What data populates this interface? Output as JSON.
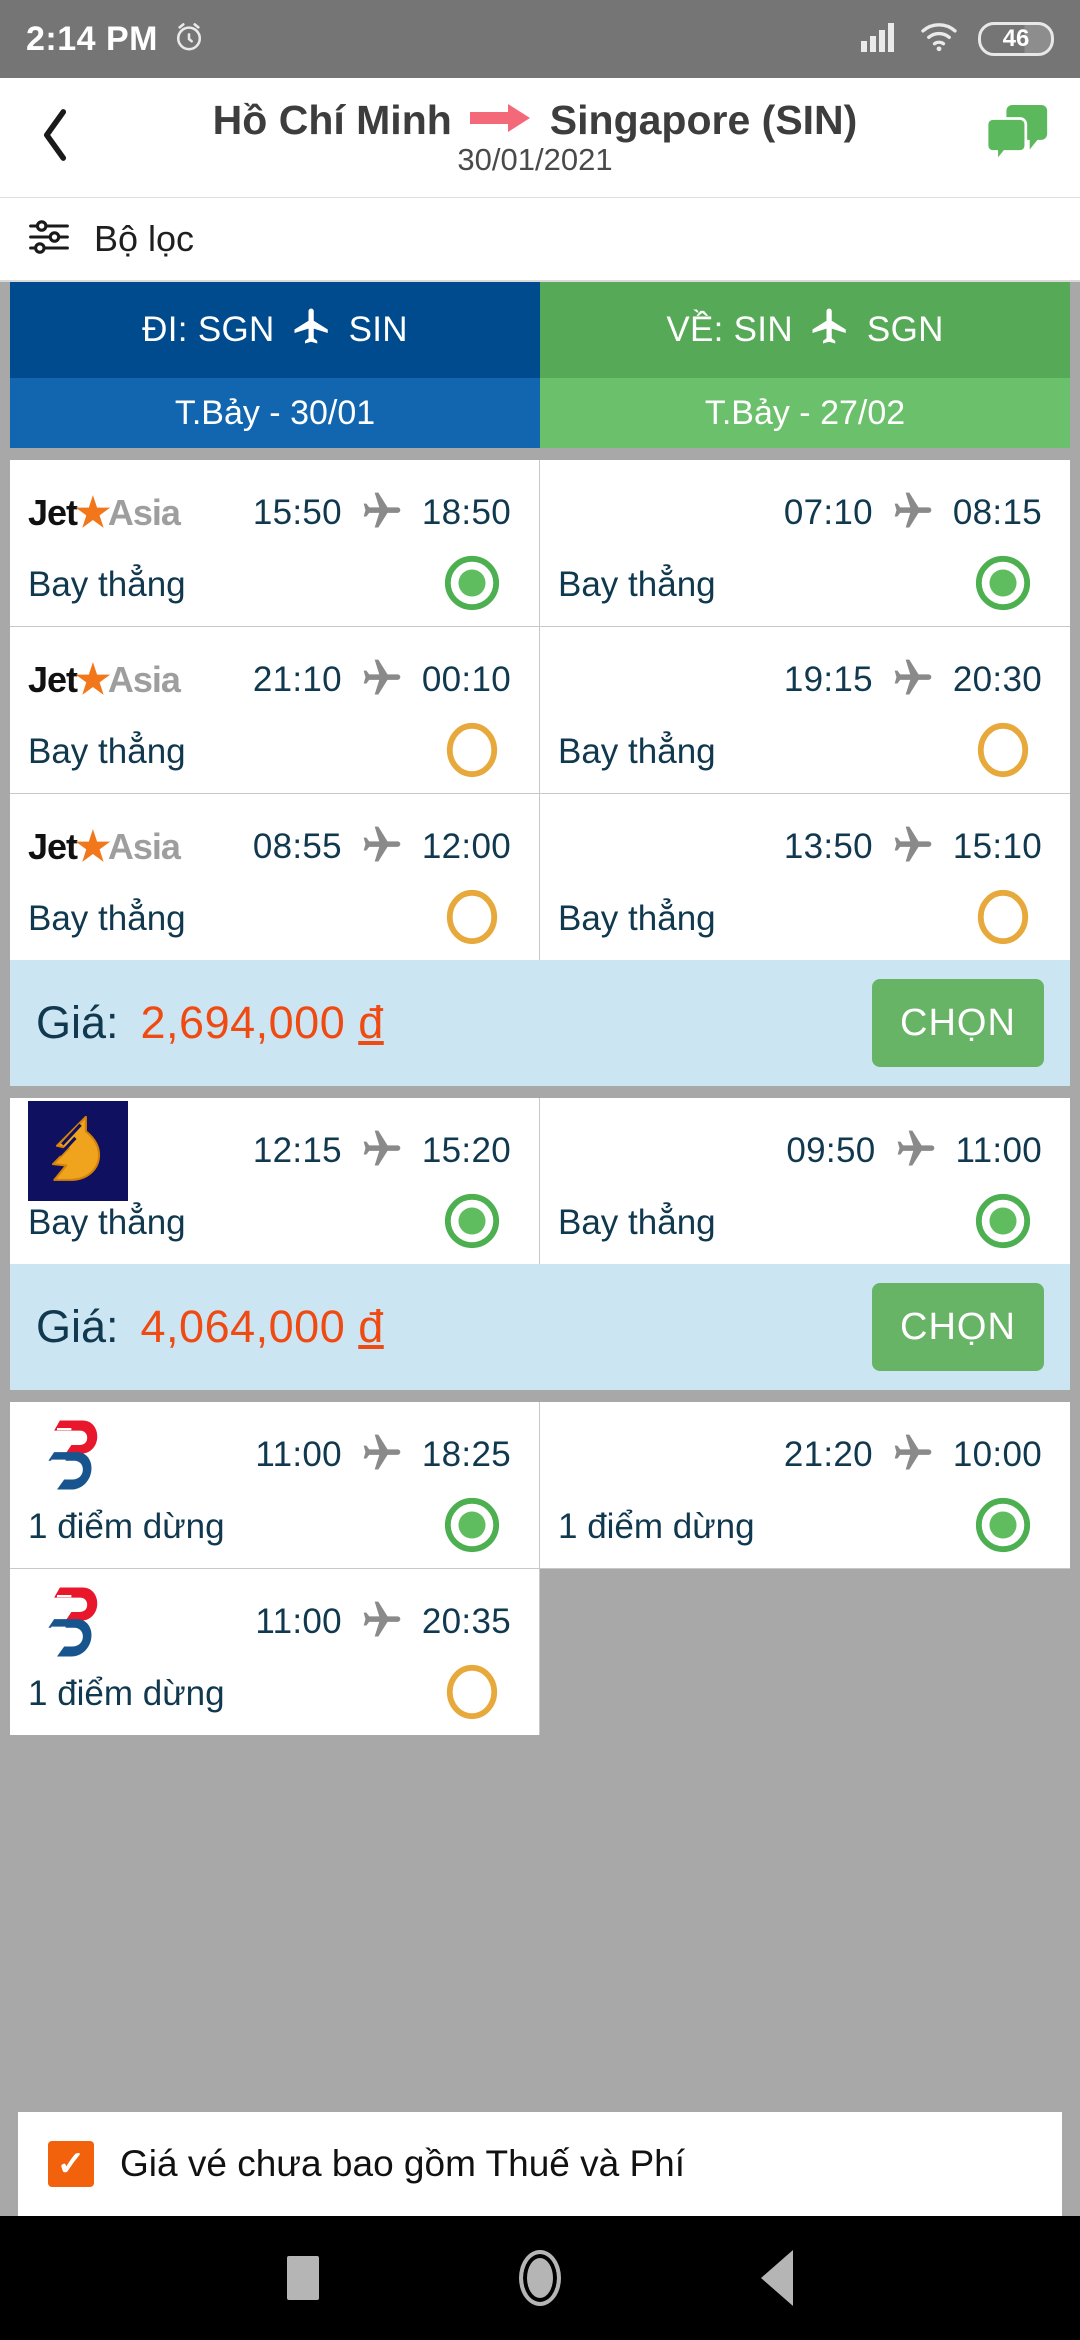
{
  "statusbar": {
    "time": "2:14 PM",
    "alarm_icon": "alarm-clock-icon",
    "signal_icon": "cellular-signal-icon",
    "wifi_icon": "wifi-icon",
    "battery_level": "46"
  },
  "header": {
    "back_icon": "back-chevron-icon",
    "origin": "Hồ Chí Minh",
    "arrow_icon": "arrow-right-icon",
    "destination": "Singapore (SIN)",
    "date": "30/01/2021",
    "chat_icon": "chat-bubbles-icon"
  },
  "filter": {
    "icon": "filter-sliders-icon",
    "label": "Bộ lọc"
  },
  "tabs": [
    {
      "name": "departure",
      "title_prefix": "ĐI: SGN",
      "title_suffix": "SIN",
      "plane_icon": "airplane-icon",
      "date": "T.Bảy - 30/01",
      "color_top": "#004b8d",
      "color_bottom": "#1266b0"
    },
    {
      "name": "return",
      "title_prefix": "VỀ: SIN",
      "title_suffix": "SGN",
      "plane_icon": "airplane-icon",
      "date": "T.Bảy - 27/02",
      "color_top": "#56a956",
      "color_bottom": "#6bc06b"
    }
  ],
  "cards": [
    {
      "rows": [
        {
          "left": {
            "airline": "jetstar-asia",
            "logo_text_a": "Jet",
            "logo_text_b": "Asia",
            "depart": "15:50",
            "arrive": "18:50",
            "stops": "Bay thẳng",
            "selected": true
          },
          "right": {
            "airline": "",
            "depart": "07:10",
            "arrive": "08:15",
            "stops": "Bay thẳng",
            "selected": true
          }
        },
        {
          "left": {
            "airline": "jetstar-asia",
            "logo_text_a": "Jet",
            "logo_text_b": "Asia",
            "depart": "21:10",
            "arrive": "00:10",
            "stops": "Bay thẳng",
            "selected": false
          },
          "right": {
            "airline": "",
            "depart": "19:15",
            "arrive": "20:30",
            "stops": "Bay thẳng",
            "selected": false
          }
        },
        {
          "left": {
            "airline": "jetstar-asia",
            "logo_text_a": "Jet",
            "logo_text_b": "Asia",
            "depart": "08:55",
            "arrive": "12:00",
            "stops": "Bay thẳng",
            "selected": false
          },
          "right": {
            "airline": "",
            "depart": "13:50",
            "arrive": "15:10",
            "stops": "Bay thẳng",
            "selected": false
          }
        }
      ],
      "price_label": "Giá:",
      "price_value": "2,694,000",
      "currency": "đ",
      "choose_label": "CHỌN"
    },
    {
      "rows": [
        {
          "left": {
            "airline": "singapore-airlines",
            "depart": "12:15",
            "arrive": "15:20",
            "stops": "Bay thẳng",
            "selected": true
          },
          "right": {
            "airline": "",
            "depart": "09:50",
            "arrive": "11:00",
            "stops": "Bay thẳng",
            "selected": true
          }
        }
      ],
      "price_label": "Giá:",
      "price_value": "4,064,000",
      "currency": "đ",
      "choose_label": "CHỌN"
    },
    {
      "rows": [
        {
          "left": {
            "airline": "malaysia-airlines",
            "depart": "11:00",
            "arrive": "18:25",
            "stops": "1 điểm dừng",
            "selected": true
          },
          "right": {
            "airline": "",
            "depart": "21:20",
            "arrive": "10:00",
            "stops": "1 điểm dừng",
            "selected": true
          }
        },
        {
          "left": {
            "airline": "malaysia-airlines",
            "depart": "11:00",
            "arrive": "20:35",
            "stops": "1 điểm dừng",
            "selected": false
          },
          "right": null
        }
      ],
      "price_label": "",
      "price_value": "",
      "currency": "",
      "choose_label": ""
    }
  ],
  "note": {
    "checked": true,
    "check_icon": "checkmark-icon",
    "text": "Giá vé chưa bao gồm Thuế và Phí"
  },
  "navbar": {
    "recents_icon": "recents-square-icon",
    "home_icon": "home-circle-icon",
    "back_icon": "back-triangle-icon"
  },
  "colors": {
    "accent_orange": "#f04a13",
    "accent_green": "#68b466",
    "price_bg": "#cbe5f2",
    "page_bg": "#a8a8a8",
    "text_dark": "#10384f"
  }
}
